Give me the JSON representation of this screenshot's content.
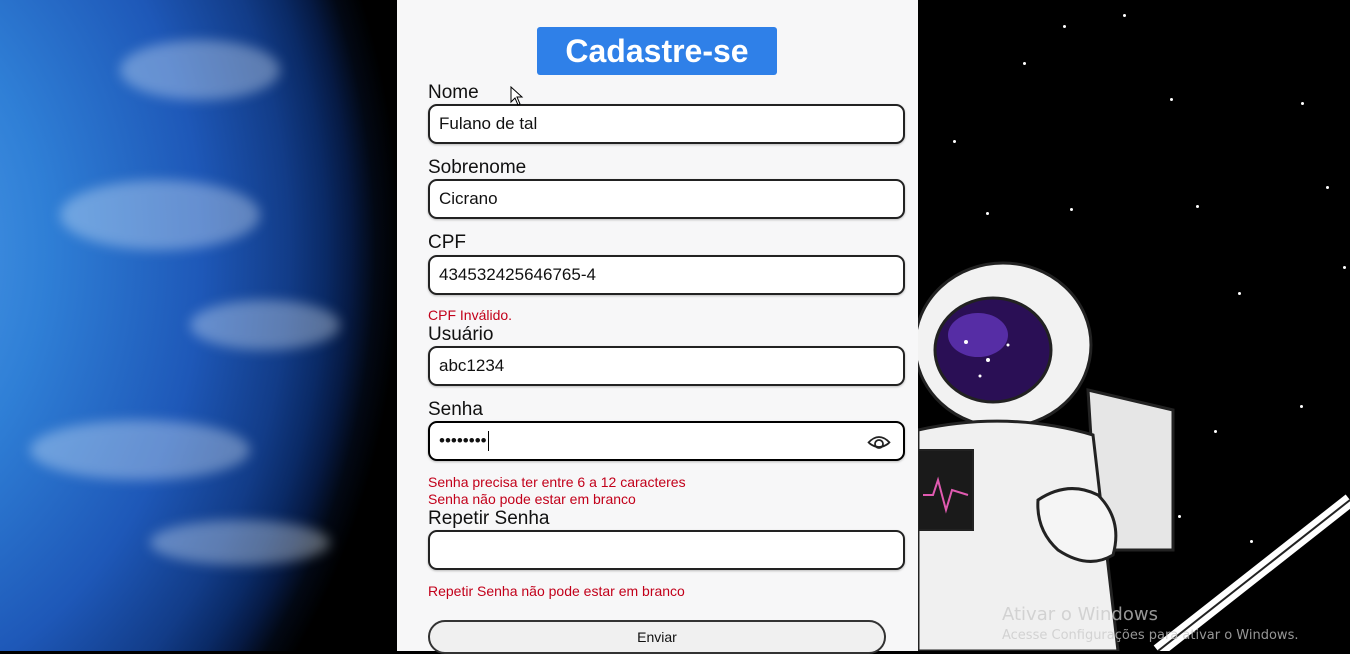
{
  "form": {
    "title": "Cadastre-se",
    "fields": [
      {
        "label": "Nome",
        "value": "Fulano de tal"
      },
      {
        "label": "Sobrenome",
        "value": "Cicrano"
      },
      {
        "label": "CPF",
        "value": "434532425646765-4",
        "error": "CPF Inválido."
      },
      {
        "label": "Usuário",
        "value": "abc1234"
      },
      {
        "label": "Senha",
        "value": "••••••••",
        "errors": [
          "Senha precisa ter entre 6 a 12 caracteres",
          "Senha não pode estar em branco"
        ]
      },
      {
        "label": "Repetir Senha",
        "value": "",
        "error": "Repetir Senha não pode estar em branco"
      }
    ],
    "submit_label": "Enviar"
  },
  "os_watermark": {
    "line1": "Ativar o Windows",
    "line2": "Acesse Configurações para ativar o Windows."
  },
  "colors": {
    "title_bg": "#2f80e8",
    "error": "#c2001a",
    "panel_bg": "#f7f7f8"
  },
  "icons": [
    "eye-icon",
    "mouse-pointer-icon"
  ]
}
